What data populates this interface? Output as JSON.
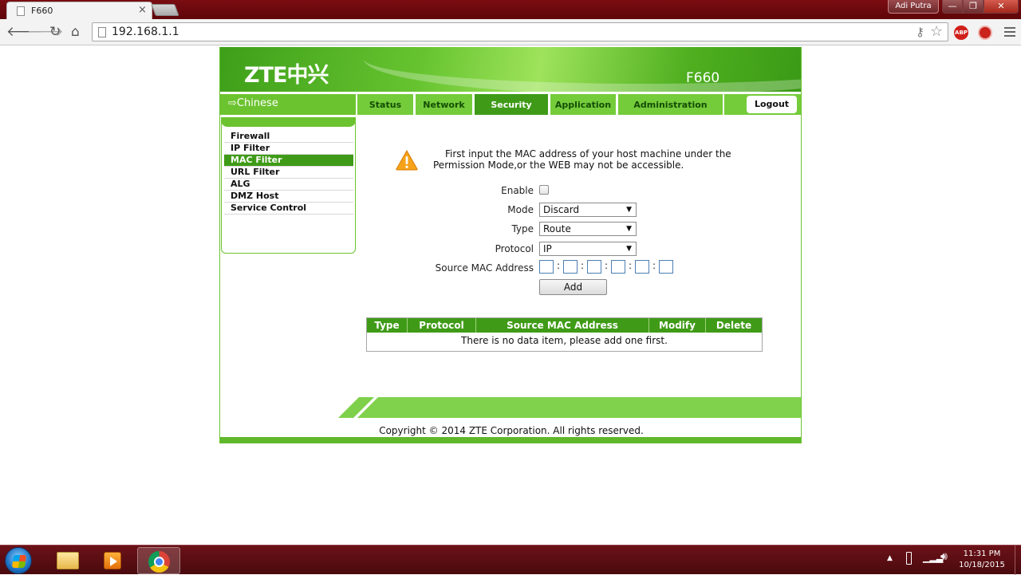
{
  "browser": {
    "tab_title": "F660",
    "tab_close": "×",
    "profile_name": "Adi Putra",
    "url": "192.168.1.1",
    "abp_label": "ABP",
    "window_buttons": {
      "minimize": "—",
      "maximize": "❐",
      "close": "✕"
    }
  },
  "router": {
    "logo": "ZTE中兴",
    "model": "F660",
    "language_link": "⇨Chinese",
    "nav_tabs": [
      {
        "label": "Status",
        "active": false
      },
      {
        "label": "Network",
        "active": false
      },
      {
        "label": "Security",
        "active": true
      },
      {
        "label": "Application",
        "active": false
      },
      {
        "label": "Administration",
        "active": false
      }
    ],
    "logout_label": "Logout",
    "sidebar_items": [
      {
        "label": "Firewall",
        "active": false
      },
      {
        "label": "IP Filter",
        "active": false
      },
      {
        "label": "MAC Filter",
        "active": true
      },
      {
        "label": "URL Filter",
        "active": false
      },
      {
        "label": "ALG",
        "active": false
      },
      {
        "label": "DMZ Host",
        "active": false
      },
      {
        "label": "Service Control",
        "active": false
      }
    ],
    "warning_text": "First input the MAC address of your host machine under the Permission Mode,or the WEB may not be accessible.",
    "form": {
      "enable_label": "Enable",
      "enable_checked": false,
      "mode_label": "Mode",
      "mode_value": "Discard",
      "type_label": "Type",
      "type_value": "Route",
      "protocol_label": "Protocol",
      "protocol_value": "IP",
      "source_mac_label": "Source MAC Address",
      "mac_separator": ":",
      "add_label": "Add"
    },
    "table": {
      "headers": [
        "Type",
        "Protocol",
        "Source MAC Address",
        "Modify",
        "Delete"
      ],
      "empty_message": "There is no data item, please add one first."
    },
    "copyright": "Copyright © 2014 ZTE Corporation. All rights reserved."
  },
  "taskbar": {
    "clock_time": "11:31 PM",
    "clock_date": "10/18/2015"
  },
  "colors": {
    "zte_green": "#6cc330",
    "active_green": "#3f9b17",
    "titlebar": "#6b0a0f"
  }
}
